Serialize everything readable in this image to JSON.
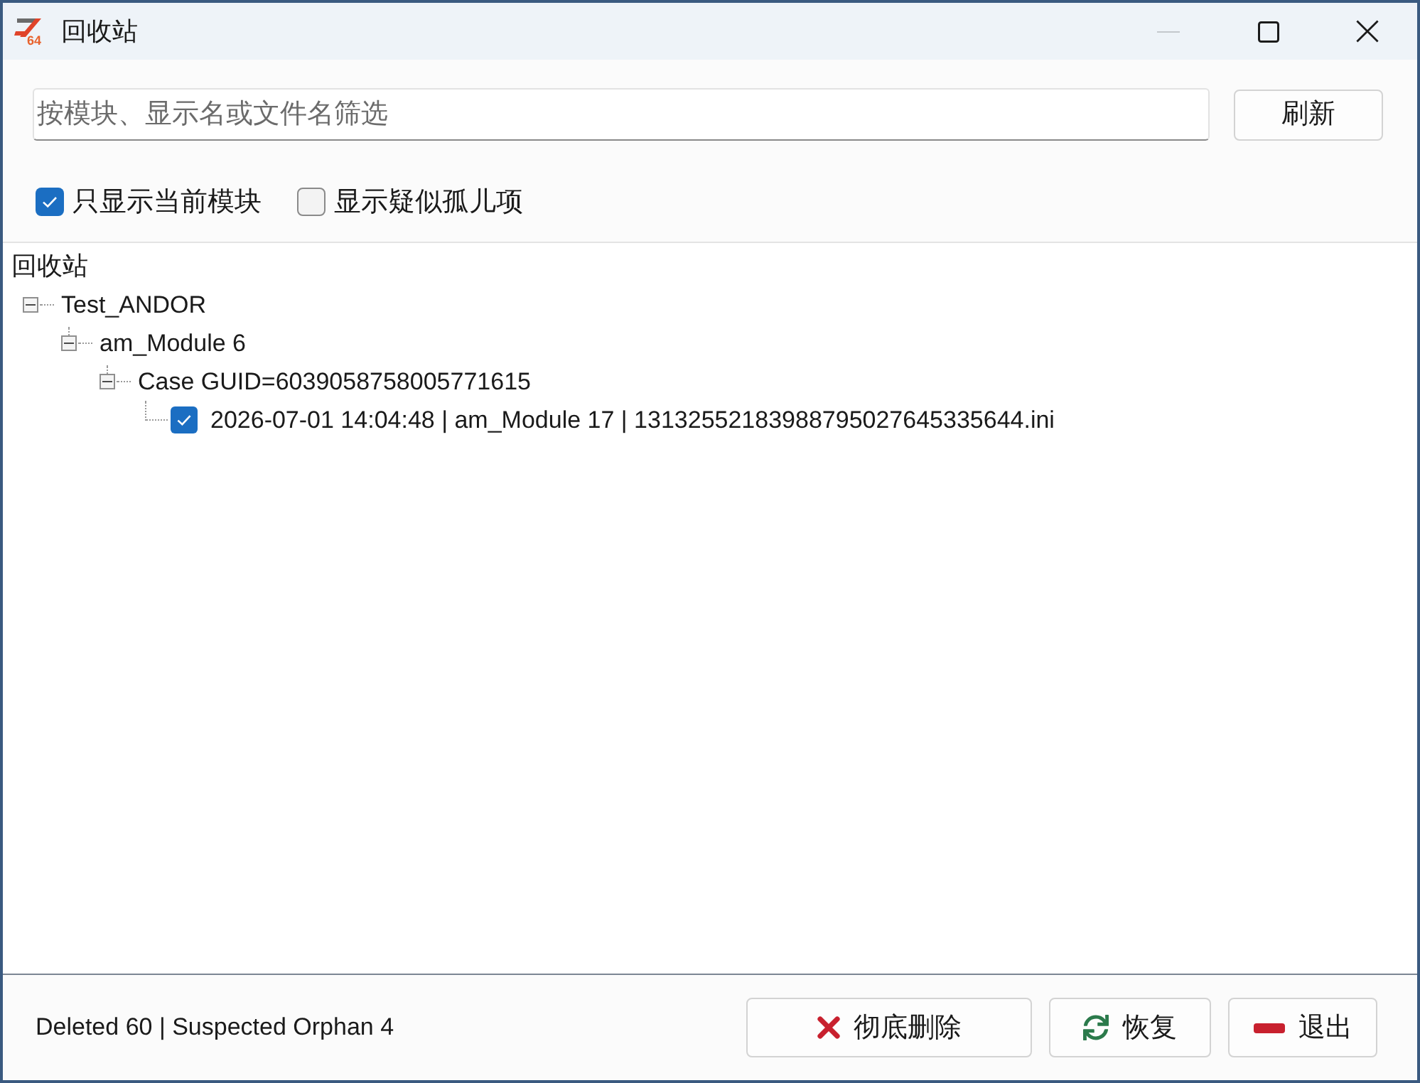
{
  "window": {
    "title": "回收站",
    "app_icon_text": "64",
    "controls": [
      {
        "kind": "minimize",
        "disabled": true
      },
      {
        "kind": "maximize",
        "disabled": false
      },
      {
        "kind": "close",
        "disabled": false
      }
    ]
  },
  "filter": {
    "placeholder": "按模块、显示名或文件名筛选",
    "refresh_button": "刷新"
  },
  "options": [
    {
      "label": "只显示当前模块",
      "checked": true
    },
    {
      "label": "显示疑似孤儿项",
      "checked": false
    }
  ],
  "tree": {
    "root_label": "回收站",
    "nodes": [
      {
        "kind": "group",
        "label": "Test_ANDOR",
        "expanded": true,
        "children": [
          {
            "kind": "group",
            "label": "am_Module 6",
            "expanded": true,
            "children": [
              {
                "kind": "group",
                "label": "Case GUID=6039058758005771615",
                "expanded": true,
                "children": [
                  {
                    "kind": "item",
                    "label": "2026-07-01 14:04:48 | am_Module 17 | 13132552183988795027645335644.ini",
                    "checked": true
                  }
                ]
              }
            ]
          }
        ]
      }
    ]
  },
  "status_bar": {
    "summary": "Deleted 60 | Suspected Orphan 4",
    "buttons": [
      {
        "kind": "delete",
        "label": "彻底删除"
      },
      {
        "kind": "restore",
        "label": "恢复"
      },
      {
        "kind": "exit",
        "label": "退出"
      }
    ]
  }
}
